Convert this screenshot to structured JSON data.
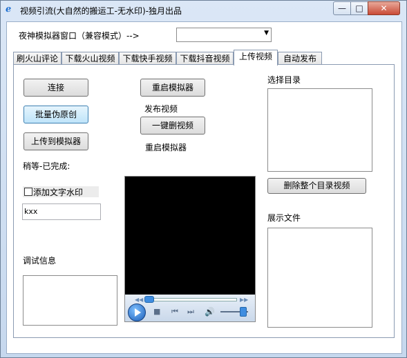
{
  "window": {
    "title": "视频引流(大自然的搬运工-无水印)-独月出品",
    "icon": "app-e-icon",
    "controls": {
      "minimize": "—",
      "maximize": "□",
      "close": "✕"
    }
  },
  "top": {
    "emulator_label": "夜神模拟器窗口（兼容模式）-->",
    "emulator_select_value": ""
  },
  "tabs": [
    {
      "label": "刷火山评论"
    },
    {
      "label": "下载火山视频"
    },
    {
      "label": "下载快手视频"
    },
    {
      "label": "下载抖音视频"
    },
    {
      "label": "上传视频",
      "active": true
    },
    {
      "label": "自动发布"
    }
  ],
  "panel": {
    "connect_button": "连接",
    "batch_button": "批量伪原创",
    "upload_button": "上传到模拟器",
    "status_text": "稍等-已完成:",
    "watermark_checkbox": "添加文字水印",
    "watermark_text": "kxx",
    "debug_label": "调试信息",
    "restart_button": "重启模拟器",
    "publish_label": "发布视频",
    "delete_button": "一键删视频",
    "restart_label": "重启模拟器",
    "select_dir_label": "选择目录",
    "delete_dir_button": "删除整个目录视频",
    "show_files_label": "展示文件"
  },
  "colors": {
    "window_frame": "#c6d8ee",
    "button_focus": "#bfe4f9",
    "player_bg": "#000000",
    "close_button": "#c94a36"
  }
}
